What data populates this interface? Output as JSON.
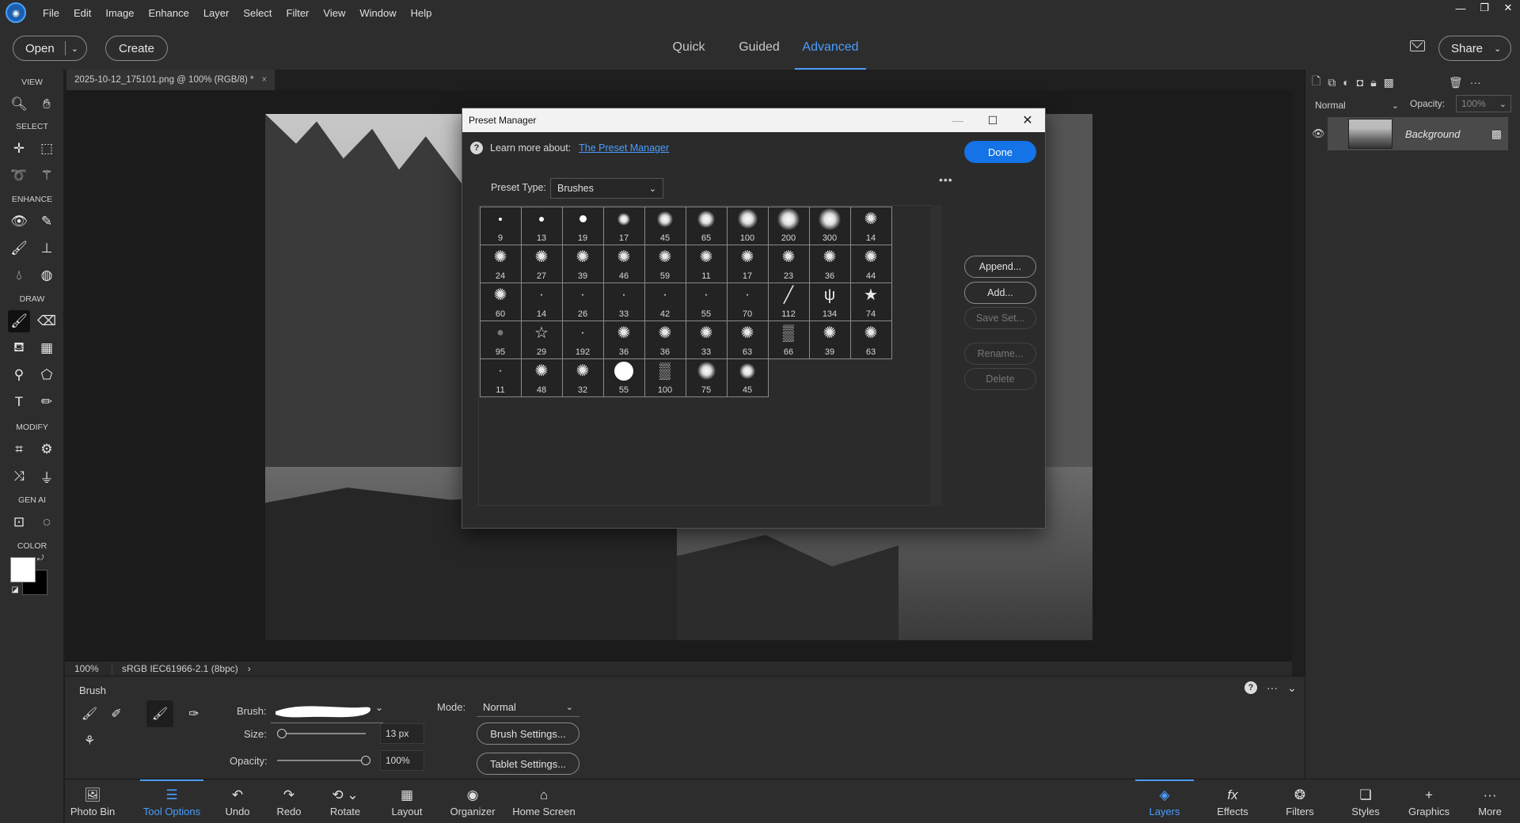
{
  "menubar": {
    "items": [
      "File",
      "Edit",
      "Image",
      "Enhance",
      "Layer",
      "Select",
      "Filter",
      "View",
      "Window",
      "Help"
    ],
    "window_controls": [
      "minimize",
      "restore",
      "close"
    ]
  },
  "header": {
    "open_label": "Open",
    "create_label": "Create",
    "share_label": "Share",
    "mode_tabs": [
      "Quick",
      "Guided",
      "Advanced"
    ],
    "active_mode": "Advanced"
  },
  "toolbar": {
    "sections": [
      "VIEW",
      "SELECT",
      "ENHANCE",
      "DRAW",
      "MODIFY",
      "GEN AI",
      "COLOR"
    ],
    "foreground_color": "#ffffff",
    "background_color": "#000000"
  },
  "document": {
    "tab_title": "2025-10-12_175101.png @ 100% (RGB/8) *",
    "zoom": "100%",
    "color_profile": "sRGB IEC61966-2.1 (8bpc)"
  },
  "tool_options": {
    "title": "Brush",
    "brush_label": "Brush:",
    "size_label": "Size:",
    "size_value": "13 px",
    "opacity_label": "Opacity:",
    "opacity_value": "100%",
    "size_fraction": 0.05,
    "opacity_fraction": 1.0,
    "mode_label": "Mode:",
    "mode_value": "Normal",
    "brush_settings_label": "Brush Settings...",
    "tablet_settings_label": "Tablet Settings..."
  },
  "taskbar": {
    "left": [
      {
        "label": "Photo Bin",
        "icon": "photo-bin-icon"
      },
      {
        "label": "Tool Options",
        "icon": "tool-options-icon",
        "active": true
      },
      {
        "label": "Undo",
        "icon": "undo-icon"
      },
      {
        "label": "Redo",
        "icon": "redo-icon"
      },
      {
        "label": "Rotate",
        "icon": "rotate-icon"
      },
      {
        "label": "Layout",
        "icon": "layout-icon"
      },
      {
        "label": "Organizer",
        "icon": "organizer-icon"
      },
      {
        "label": "Home Screen",
        "icon": "home-icon"
      }
    ],
    "right": [
      {
        "label": "Layers",
        "icon": "layers-icon",
        "active": true
      },
      {
        "label": "Effects",
        "icon": "fx-icon"
      },
      {
        "label": "Filters",
        "icon": "filters-icon"
      },
      {
        "label": "Styles",
        "icon": "styles-icon"
      },
      {
        "label": "Graphics",
        "icon": "plus-icon"
      },
      {
        "label": "More",
        "icon": "more-icon"
      }
    ]
  },
  "layers": {
    "blend_mode": "Normal",
    "opacity_label": "Opacity:",
    "opacity_value": "100%",
    "layer_name": "Background"
  },
  "dialog": {
    "title": "Preset Manager",
    "learn_more": "Learn more about:",
    "link_text": "The Preset Manager",
    "done_label": "Done",
    "preset_type_label": "Preset Type:",
    "preset_type_value": "Brushes",
    "buttons": [
      {
        "label": "Append...",
        "enabled": true
      },
      {
        "label": "Add...",
        "enabled": true
      },
      {
        "label": "Save Set...",
        "enabled": false
      },
      {
        "label": "Rename...",
        "enabled": false
      },
      {
        "label": "Delete",
        "enabled": false
      }
    ],
    "brushes": [
      {
        "size": "9",
        "kind": "hard"
      },
      {
        "size": "13",
        "kind": "hard"
      },
      {
        "size": "19",
        "kind": "hard"
      },
      {
        "size": "17",
        "kind": "soft"
      },
      {
        "size": "45",
        "kind": "soft"
      },
      {
        "size": "65",
        "kind": "soft"
      },
      {
        "size": "100",
        "kind": "soft"
      },
      {
        "size": "200",
        "kind": "soft"
      },
      {
        "size": "300",
        "kind": "soft"
      },
      {
        "size": "14",
        "kind": "splat"
      },
      {
        "size": "24",
        "kind": "splat"
      },
      {
        "size": "27",
        "kind": "splat"
      },
      {
        "size": "39",
        "kind": "splat"
      },
      {
        "size": "46",
        "kind": "splat"
      },
      {
        "size": "59",
        "kind": "splat"
      },
      {
        "size": "11",
        "kind": "splat"
      },
      {
        "size": "17",
        "kind": "splat"
      },
      {
        "size": "23",
        "kind": "splat"
      },
      {
        "size": "36",
        "kind": "splat"
      },
      {
        "size": "44",
        "kind": "splat"
      },
      {
        "size": "60",
        "kind": "splat"
      },
      {
        "size": "14",
        "kind": "tiny"
      },
      {
        "size": "26",
        "kind": "tiny"
      },
      {
        "size": "33",
        "kind": "tiny"
      },
      {
        "size": "42",
        "kind": "tiny"
      },
      {
        "size": "55",
        "kind": "tiny"
      },
      {
        "size": "70",
        "kind": "tiny"
      },
      {
        "size": "112",
        "kind": "stroke"
      },
      {
        "size": "134",
        "kind": "grass"
      },
      {
        "size": "74",
        "kind": "star"
      },
      {
        "size": "95",
        "kind": "drop"
      },
      {
        "size": "29",
        "kind": "star-outline"
      },
      {
        "size": "192",
        "kind": "tiny"
      },
      {
        "size": "36",
        "kind": "splat"
      },
      {
        "size": "36",
        "kind": "splat"
      },
      {
        "size": "33",
        "kind": "splat"
      },
      {
        "size": "63",
        "kind": "splat"
      },
      {
        "size": "66",
        "kind": "texture"
      },
      {
        "size": "39",
        "kind": "splat"
      },
      {
        "size": "63",
        "kind": "splat"
      },
      {
        "size": "11",
        "kind": "tiny"
      },
      {
        "size": "48",
        "kind": "splat"
      },
      {
        "size": "32",
        "kind": "splat"
      },
      {
        "size": "55",
        "kind": "hard"
      },
      {
        "size": "100",
        "kind": "texture"
      },
      {
        "size": "75",
        "kind": "soft"
      },
      {
        "size": "45",
        "kind": "soft"
      }
    ]
  }
}
